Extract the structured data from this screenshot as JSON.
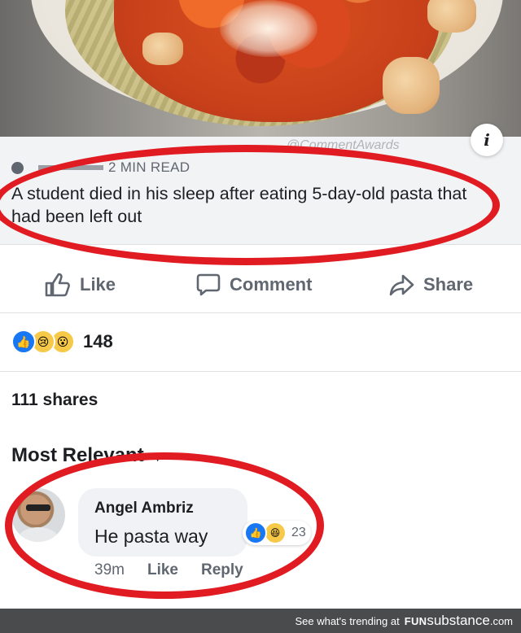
{
  "watermark": "@CommentAwards",
  "link_card": {
    "source_suffix": "2 MIN READ",
    "headline": "A student died in his sleep after eating 5-day-old pasta that had been left out",
    "info_icon": "i"
  },
  "actions": {
    "like_label": "Like",
    "comment_label": "Comment",
    "share_label": "Share"
  },
  "reactions": {
    "icons": [
      "like-icon",
      "sad-icon",
      "wow-icon"
    ],
    "count": "148"
  },
  "shares": "111 shares",
  "comments_sort": "Most Relevant",
  "comment": {
    "author": "Angel Ambriz",
    "text": "He pasta way",
    "reaction_icons": [
      "like-icon",
      "haha-icon"
    ],
    "reaction_count": "23",
    "time": "39m",
    "like_label": "Like",
    "reply_label": "Reply"
  },
  "footer": {
    "text": "See what's trending at",
    "brand_bold": "FUN",
    "brand_main": "substance",
    "brand_tld": ".com"
  },
  "colors": {
    "annotation_red": "#e11b22",
    "facebook_blue": "#1877f2",
    "muted_text": "#606770"
  }
}
